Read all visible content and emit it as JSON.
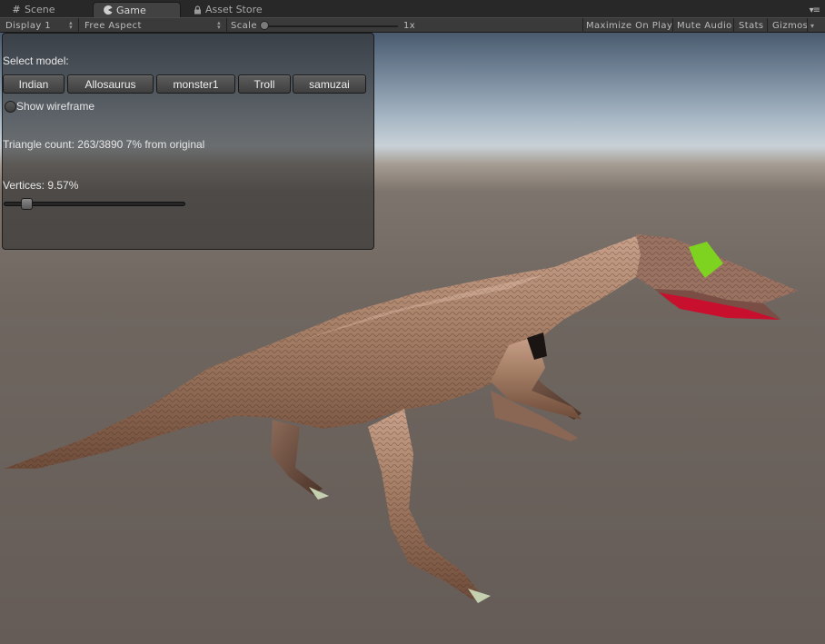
{
  "tabs": [
    {
      "label": "Scene",
      "icon": "grid-icon",
      "active": false
    },
    {
      "label": "Game",
      "icon": "pacman-icon",
      "active": true
    },
    {
      "label": "Asset Store",
      "icon": "lock-icon",
      "active": false
    }
  ],
  "toolbar": {
    "display": "Display 1",
    "aspect": "Free Aspect",
    "scale_label": "Scale",
    "scale_value": "1x",
    "maximize_on_play": "Maximize On Play",
    "mute_audio": "Mute Audio",
    "stats": "Stats",
    "gizmos": "Gizmos"
  },
  "panel": {
    "select_model_label": "Select model:",
    "models": [
      "Indian",
      "Allosaurus",
      "monster1",
      "Troll",
      "samuzai"
    ],
    "show_wireframe_label": "Show wireframe",
    "show_wireframe_checked": false,
    "triangle_count_text": "Triangle count: 263/3890 7% from original",
    "vertices_label": "Vertices: 9.57%",
    "vertices_slider_fraction": 0.0957
  },
  "colors": {
    "sky_top": "#4a5b6f",
    "horizon": "#c9d1d7",
    "ground": "#6a615b",
    "dino_skin": "#a27b63",
    "dino_mouth": "#c8102e",
    "dino_eye_patch": "#7ed321"
  }
}
